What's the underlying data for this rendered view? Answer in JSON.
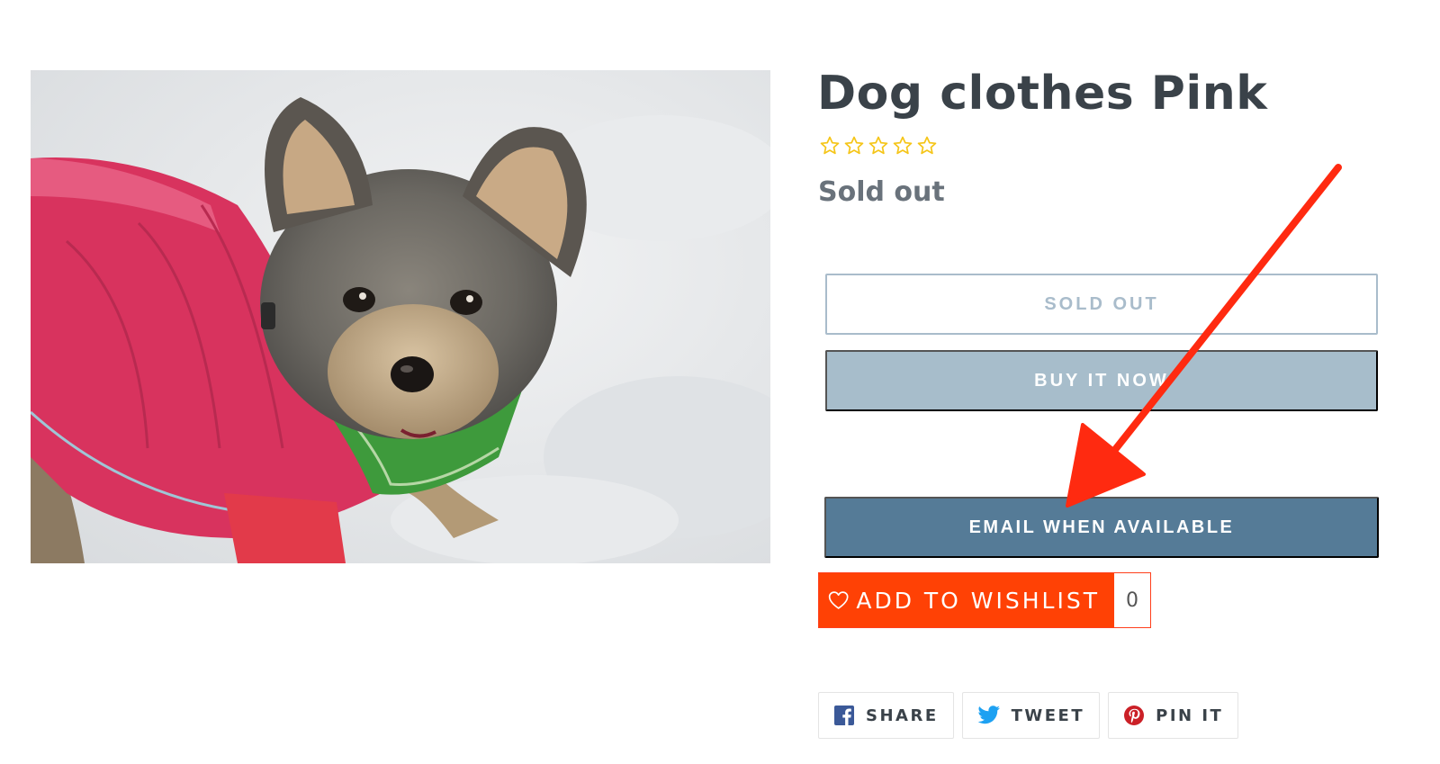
{
  "product": {
    "title": "Dog clothes Pink",
    "rating_stars": 5,
    "rating_value": 0,
    "status_text": "Sold out",
    "image": {
      "alt": "Yorkshire terrier wearing a pink winter jacket in the snow"
    }
  },
  "buttons": {
    "sold_out": "SOLD OUT",
    "buy_now": "BUY IT NOW",
    "email_when_available": "EMAIL WHEN AVAILABLE"
  },
  "wishlist": {
    "label": "ADD TO WISHLIST",
    "count": "0"
  },
  "share": {
    "facebook": "SHARE",
    "twitter": "TWEET",
    "pinterest": "PIN IT"
  },
  "colors": {
    "title": "#3a4249",
    "star": "#f5c518",
    "sold_out_border": "#a9bccb",
    "buy_now_bg": "#a7bdcb",
    "email_bg": "#557b97",
    "wishlist_bg": "#ff4105",
    "arrow": "#ff2a10",
    "facebook": "#3b5998",
    "twitter": "#1da1f2",
    "pinterest": "#cb2027"
  },
  "icons": [
    "star-outline-icon",
    "heart-outline-icon",
    "facebook-icon",
    "twitter-icon",
    "pinterest-icon",
    "annotation-arrow"
  ]
}
